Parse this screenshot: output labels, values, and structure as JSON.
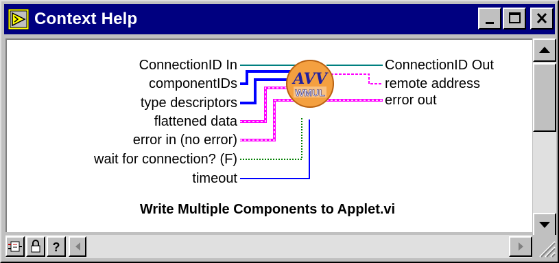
{
  "window": {
    "title": "Context Help"
  },
  "terminals": {
    "inputs": [
      "ConnectionID In",
      "componentIDs",
      "type descriptors",
      "flattened data",
      "error in (no error)",
      "wait for connection? (F)",
      "timeout"
    ],
    "outputs": [
      "ConnectionID Out",
      "remote address",
      "error out"
    ]
  },
  "vi_icon": {
    "glyph": "AVV",
    "text": "WMUL",
    "color": "#f4a040"
  },
  "vi_name": "Write Multiple Components to Applet.vi",
  "icons": {
    "app": "labview-help-icon",
    "toolbar": [
      "show-hide-terminals-icon",
      "lock-icon",
      "help-question-icon"
    ]
  },
  "colors": {
    "titlebar": "#000080",
    "wire_refnum": "#008080",
    "wire_array": "#0000ff",
    "wire_cluster": "#ff00ff",
    "wire_bool": "#008000"
  }
}
